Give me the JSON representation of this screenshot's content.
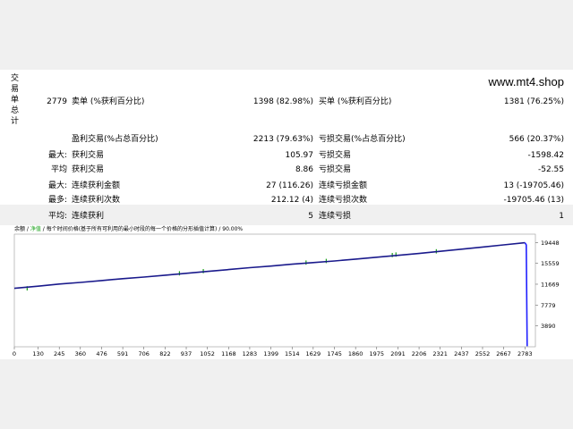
{
  "watermark": "www.mt4.shop",
  "side_label": [
    "交",
    "易",
    "单",
    "总",
    "计"
  ],
  "rows": [
    {
      "c1": "2779",
      "c2": "卖单 (%获利百分比)",
      "c3": "1398 (82.98%)",
      "c4": "买单 (%获利百分比)",
      "c5": "1381 (76.25%)"
    },
    {
      "c1": "",
      "c2": "盈利交易(%占总百分比)",
      "c3": "2213 (79.63%)",
      "c4": "亏损交易(%占总百分比)",
      "c5": "566 (20.37%)"
    },
    {
      "c1": "最大:",
      "c2": "获利交易",
      "c3": "105.97",
      "c4": "亏损交易",
      "c5": "-1598.42"
    },
    {
      "c1": "平均",
      "c2": "获利交易",
      "c3": "8.86",
      "c4": "亏损交易",
      "c5": "-52.55"
    },
    {
      "c1": "最大:",
      "c2": "连续获利金额",
      "c3": "27 (116.26)",
      "c4": "连续亏损金额",
      "c5": "13 (-19705.46)"
    },
    {
      "c1": "最多:",
      "c2": "连续获利次数",
      "c3": "212.12 (4)",
      "c4": "连续亏损次数",
      "c5": "-19705.46 (13)"
    },
    {
      "c1": "平均:",
      "c2": "连续获利",
      "c3": "5",
      "c4": "连续亏损",
      "c5": "1"
    }
  ],
  "chart": {
    "title_a": "余额",
    "title_b": "净值",
    "title_c": "每个时间价格(基于所有可利用的最小时段的每一个价格的分形插值计算)",
    "title_d": "90.00%",
    "colors": {
      "balance": "#1a1a8c",
      "equity": "#1aa11a",
      "drop": "#2020ff"
    }
  },
  "chart_data": {
    "type": "line",
    "x_ticks": [
      0,
      130,
      245,
      360,
      476,
      591,
      706,
      822,
      937,
      1052,
      1168,
      1283,
      1399,
      1514,
      1629,
      1745,
      1860,
      1975,
      2091,
      2206,
      2321,
      2437,
      2552,
      2667,
      2783
    ],
    "y_ticks": [
      19448,
      15559,
      11669,
      7779,
      3890
    ],
    "xlim": [
      0,
      2840
    ],
    "ylim": [
      0,
      21000
    ],
    "series": [
      {
        "x": [
          0,
          130,
          245,
          360,
          476,
          591,
          706,
          822,
          937,
          1052,
          1168,
          1283,
          1399,
          1514,
          1629,
          1745,
          1860,
          1975,
          2091,
          2206,
          2321,
          2437,
          2552,
          2667,
          2783,
          2790,
          2795
        ],
        "y": [
          10900,
          11300,
          11700,
          12000,
          12350,
          12700,
          13000,
          13350,
          13700,
          14050,
          14400,
          14750,
          15050,
          15400,
          15700,
          16000,
          16350,
          16700,
          17050,
          17400,
          17800,
          18200,
          18600,
          19000,
          19400,
          19000,
          100
        ]
      }
    ],
    "equity_dips": [
      {
        "x": 70,
        "y": 10500
      },
      {
        "x": 900,
        "y": 13300
      },
      {
        "x": 1030,
        "y": 13700
      },
      {
        "x": 1590,
        "y": 15300
      },
      {
        "x": 1700,
        "y": 15600
      },
      {
        "x": 2060,
        "y": 16700
      },
      {
        "x": 2080,
        "y": 16800
      },
      {
        "x": 2300,
        "y": 17400
      }
    ]
  }
}
